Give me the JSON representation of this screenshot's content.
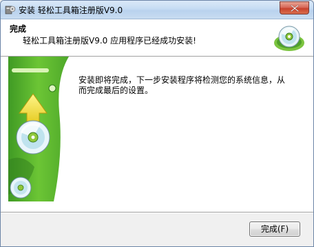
{
  "window": {
    "title": "安装 轻松工具箱注册版V9.0",
    "icons": {
      "app": "installer-icon",
      "close": "close-icon"
    }
  },
  "header": {
    "title": "完成",
    "subtitle": "轻松工具箱注册版V9.0 应用程序已经成功安装!",
    "icon": "cd-disc-icon"
  },
  "main": {
    "message": "安装即将完成，下一步安装程序将检测您的系统信息，从而完成最后的设置。",
    "side_art": "installer-banner-art"
  },
  "footer": {
    "finish_label": "完成(F)"
  },
  "colors": {
    "banner_green": "#5fbe2c",
    "arrow_yellow": "#f3e23a",
    "close_red": "#c8422d"
  }
}
